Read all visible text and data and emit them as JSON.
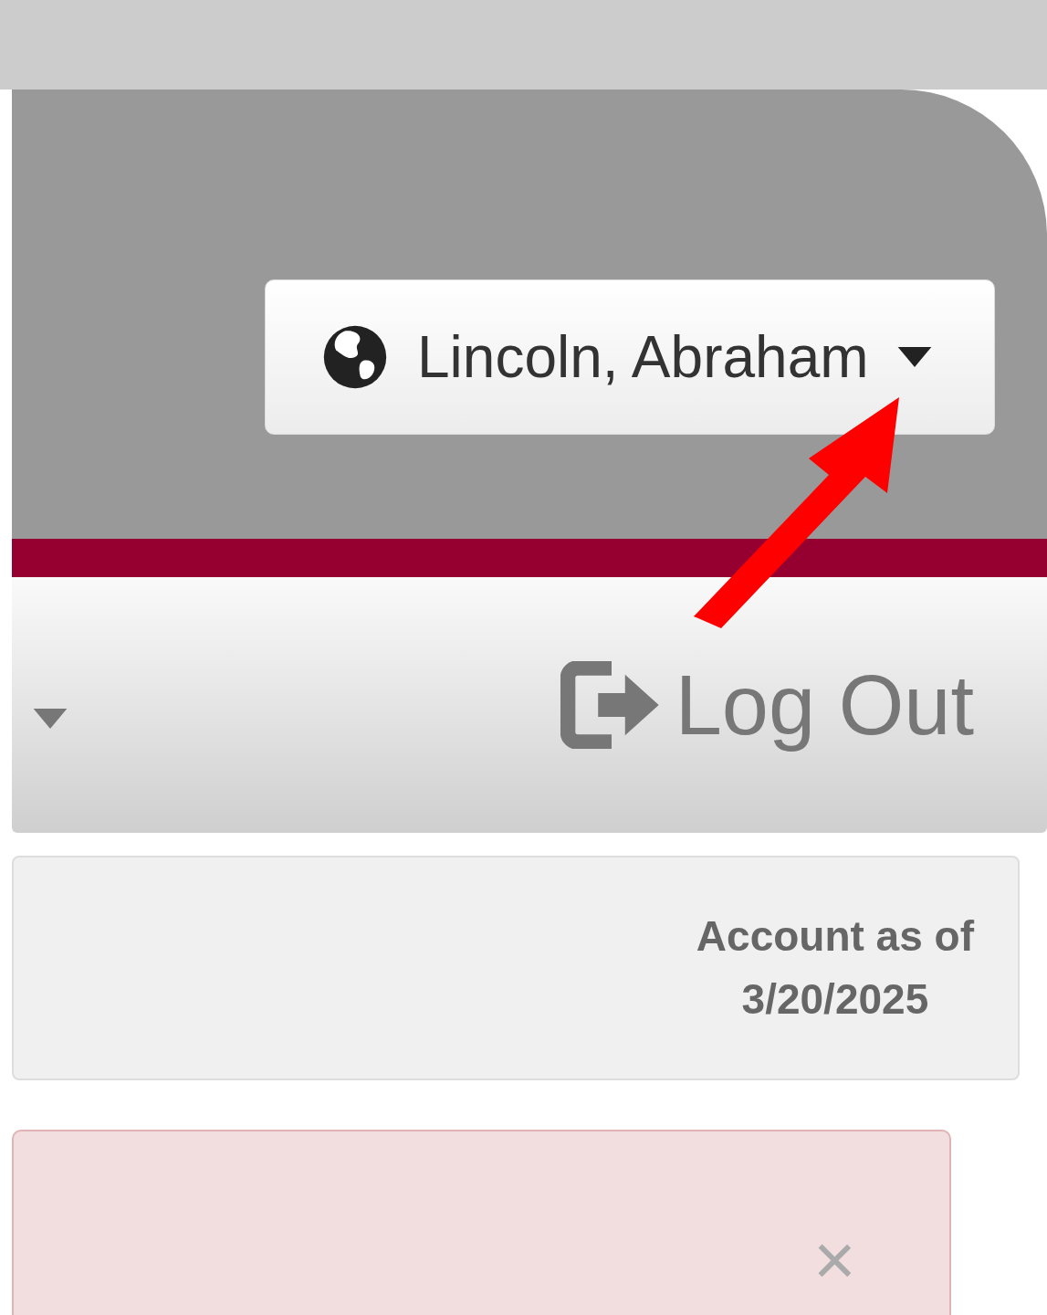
{
  "header": {
    "user_menu": {
      "name": "Lincoln, Abraham"
    }
  },
  "nav": {
    "logout": "Log Out"
  },
  "account": {
    "label": "Account as of",
    "date": "3/20/2025"
  },
  "alert": {
    "close": "×"
  }
}
